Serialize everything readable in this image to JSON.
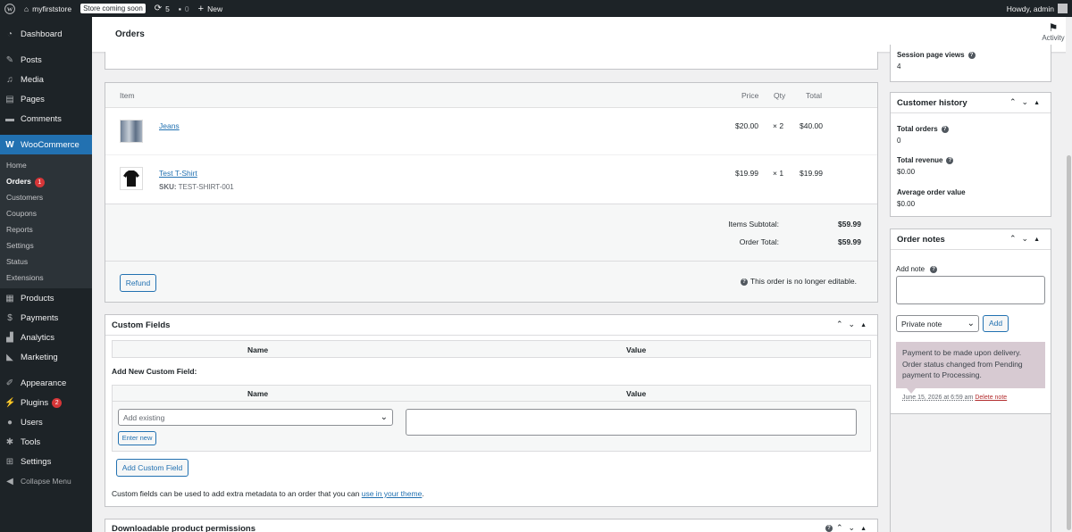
{
  "adminbar": {
    "site_name": "myfirststore",
    "store_badge": "Store coming soon",
    "updates_count": "5",
    "comments_count": "0",
    "new_label": "New",
    "howdy": "Howdy, admin"
  },
  "sidebar": {
    "dashboard": "Dashboard",
    "posts": "Posts",
    "media": "Media",
    "pages": "Pages",
    "comments": "Comments",
    "woocommerce": "WooCommerce",
    "sub_home": "Home",
    "sub_orders": "Orders",
    "sub_orders_count": "1",
    "sub_customers": "Customers",
    "sub_coupons": "Coupons",
    "sub_reports": "Reports",
    "sub_settings": "Settings",
    "sub_status": "Status",
    "sub_extensions": "Extensions",
    "products": "Products",
    "payments": "Payments",
    "analytics": "Analytics",
    "marketing": "Marketing",
    "appearance": "Appearance",
    "plugins": "Plugins",
    "plugins_count": "2",
    "users": "Users",
    "tools": "Tools",
    "settings": "Settings",
    "collapse": "Collapse Menu"
  },
  "header": {
    "title": "Orders",
    "activity": "Activity"
  },
  "items": {
    "col_item": "Item",
    "col_price": "Price",
    "col_qty": "Qty",
    "col_total": "Total",
    "rows": [
      {
        "name": "Jeans",
        "sku_label": "",
        "sku": "",
        "price": "$20.00",
        "qty": "× 2",
        "total": "$40.00"
      },
      {
        "name": "Test T-Shirt",
        "sku_label": "SKU:",
        "sku": "TEST-SHIRT-001",
        "price": "$19.99",
        "qty": "× 1",
        "total": "$19.99"
      }
    ],
    "subtotal_label": "Items Subtotal:",
    "subtotal": "$59.99",
    "order_total_label": "Order Total:",
    "order_total": "$59.99",
    "refund": "Refund",
    "not_editable": "This order is no longer editable."
  },
  "custom_fields": {
    "title": "Custom Fields",
    "col_name": "Name",
    "col_value": "Value",
    "add_new_label": "Add New Custom Field:",
    "select_placeholder": "Add existing",
    "enter_new": "Enter new",
    "add_button": "Add Custom Field",
    "footnote_pre": "Custom fields can be used to add extra metadata to an order that you can ",
    "footnote_link": "use in your theme",
    "footnote_post": "."
  },
  "downloads": {
    "title": "Downloadable product permissions"
  },
  "right": {
    "session_views_label": "Session page views",
    "session_views": "4",
    "history_title": "Customer history",
    "total_orders_label": "Total orders",
    "total_orders": "0",
    "total_revenue_label": "Total revenue",
    "total_revenue": "$0.00",
    "avg_value_label": "Average order value",
    "avg_value": "$0.00",
    "notes_title": "Order notes",
    "add_note_label": "Add note",
    "note_type": "Private note",
    "add_button": "Add",
    "note_text": "Payment to be made upon delivery. Order status changed from Pending payment to Processing.",
    "note_date": "June 15, 2026 at 6:59 am",
    "delete_note": "Delete note"
  },
  "colors": {
    "adminbar_bg": "#1d2327",
    "accent": "#2271b1",
    "note_bg": "#d7cad2",
    "badge": "#d63638"
  }
}
